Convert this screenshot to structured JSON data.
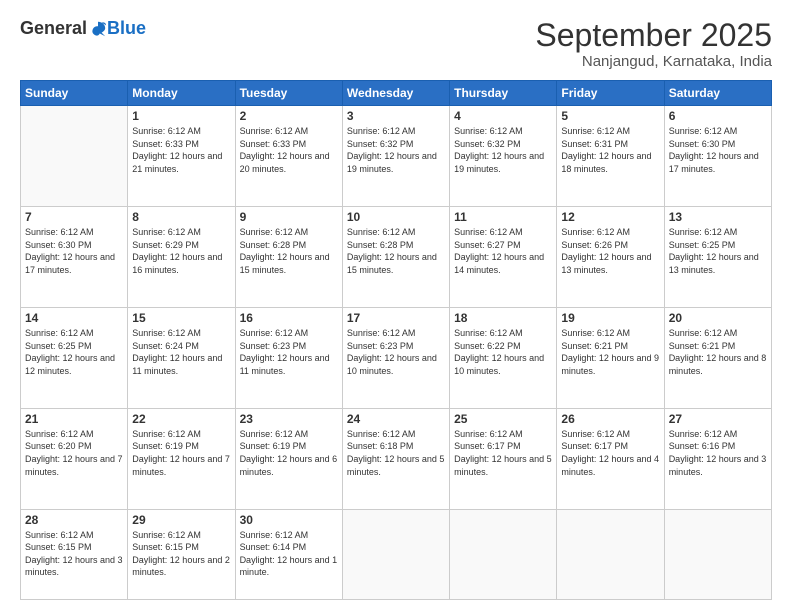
{
  "header": {
    "logo_general": "General",
    "logo_blue": "Blue",
    "month_title": "September 2025",
    "location": "Nanjangud, Karnataka, India"
  },
  "days_of_week": [
    "Sunday",
    "Monday",
    "Tuesday",
    "Wednesday",
    "Thursday",
    "Friday",
    "Saturday"
  ],
  "weeks": [
    [
      {
        "num": "",
        "sunrise": "",
        "sunset": "",
        "daylight": "",
        "empty": true
      },
      {
        "num": "1",
        "sunrise": "Sunrise: 6:12 AM",
        "sunset": "Sunset: 6:33 PM",
        "daylight": "Daylight: 12 hours and 21 minutes."
      },
      {
        "num": "2",
        "sunrise": "Sunrise: 6:12 AM",
        "sunset": "Sunset: 6:33 PM",
        "daylight": "Daylight: 12 hours and 20 minutes."
      },
      {
        "num": "3",
        "sunrise": "Sunrise: 6:12 AM",
        "sunset": "Sunset: 6:32 PM",
        "daylight": "Daylight: 12 hours and 19 minutes."
      },
      {
        "num": "4",
        "sunrise": "Sunrise: 6:12 AM",
        "sunset": "Sunset: 6:32 PM",
        "daylight": "Daylight: 12 hours and 19 minutes."
      },
      {
        "num": "5",
        "sunrise": "Sunrise: 6:12 AM",
        "sunset": "Sunset: 6:31 PM",
        "daylight": "Daylight: 12 hours and 18 minutes."
      },
      {
        "num": "6",
        "sunrise": "Sunrise: 6:12 AM",
        "sunset": "Sunset: 6:30 PM",
        "daylight": "Daylight: 12 hours and 17 minutes."
      }
    ],
    [
      {
        "num": "7",
        "sunrise": "Sunrise: 6:12 AM",
        "sunset": "Sunset: 6:30 PM",
        "daylight": "Daylight: 12 hours and 17 minutes."
      },
      {
        "num": "8",
        "sunrise": "Sunrise: 6:12 AM",
        "sunset": "Sunset: 6:29 PM",
        "daylight": "Daylight: 12 hours and 16 minutes."
      },
      {
        "num": "9",
        "sunrise": "Sunrise: 6:12 AM",
        "sunset": "Sunset: 6:28 PM",
        "daylight": "Daylight: 12 hours and 15 minutes."
      },
      {
        "num": "10",
        "sunrise": "Sunrise: 6:12 AM",
        "sunset": "Sunset: 6:28 PM",
        "daylight": "Daylight: 12 hours and 15 minutes."
      },
      {
        "num": "11",
        "sunrise": "Sunrise: 6:12 AM",
        "sunset": "Sunset: 6:27 PM",
        "daylight": "Daylight: 12 hours and 14 minutes."
      },
      {
        "num": "12",
        "sunrise": "Sunrise: 6:12 AM",
        "sunset": "Sunset: 6:26 PM",
        "daylight": "Daylight: 12 hours and 13 minutes."
      },
      {
        "num": "13",
        "sunrise": "Sunrise: 6:12 AM",
        "sunset": "Sunset: 6:25 PM",
        "daylight": "Daylight: 12 hours and 13 minutes."
      }
    ],
    [
      {
        "num": "14",
        "sunrise": "Sunrise: 6:12 AM",
        "sunset": "Sunset: 6:25 PM",
        "daylight": "Daylight: 12 hours and 12 minutes."
      },
      {
        "num": "15",
        "sunrise": "Sunrise: 6:12 AM",
        "sunset": "Sunset: 6:24 PM",
        "daylight": "Daylight: 12 hours and 11 minutes."
      },
      {
        "num": "16",
        "sunrise": "Sunrise: 6:12 AM",
        "sunset": "Sunset: 6:23 PM",
        "daylight": "Daylight: 12 hours and 11 minutes."
      },
      {
        "num": "17",
        "sunrise": "Sunrise: 6:12 AM",
        "sunset": "Sunset: 6:23 PM",
        "daylight": "Daylight: 12 hours and 10 minutes."
      },
      {
        "num": "18",
        "sunrise": "Sunrise: 6:12 AM",
        "sunset": "Sunset: 6:22 PM",
        "daylight": "Daylight: 12 hours and 10 minutes."
      },
      {
        "num": "19",
        "sunrise": "Sunrise: 6:12 AM",
        "sunset": "Sunset: 6:21 PM",
        "daylight": "Daylight: 12 hours and 9 minutes."
      },
      {
        "num": "20",
        "sunrise": "Sunrise: 6:12 AM",
        "sunset": "Sunset: 6:21 PM",
        "daylight": "Daylight: 12 hours and 8 minutes."
      }
    ],
    [
      {
        "num": "21",
        "sunrise": "Sunrise: 6:12 AM",
        "sunset": "Sunset: 6:20 PM",
        "daylight": "Daylight: 12 hours and 7 minutes."
      },
      {
        "num": "22",
        "sunrise": "Sunrise: 6:12 AM",
        "sunset": "Sunset: 6:19 PM",
        "daylight": "Daylight: 12 hours and 7 minutes."
      },
      {
        "num": "23",
        "sunrise": "Sunrise: 6:12 AM",
        "sunset": "Sunset: 6:19 PM",
        "daylight": "Daylight: 12 hours and 6 minutes."
      },
      {
        "num": "24",
        "sunrise": "Sunrise: 6:12 AM",
        "sunset": "Sunset: 6:18 PM",
        "daylight": "Daylight: 12 hours and 5 minutes."
      },
      {
        "num": "25",
        "sunrise": "Sunrise: 6:12 AM",
        "sunset": "Sunset: 6:17 PM",
        "daylight": "Daylight: 12 hours and 5 minutes."
      },
      {
        "num": "26",
        "sunrise": "Sunrise: 6:12 AM",
        "sunset": "Sunset: 6:17 PM",
        "daylight": "Daylight: 12 hours and 4 minutes."
      },
      {
        "num": "27",
        "sunrise": "Sunrise: 6:12 AM",
        "sunset": "Sunset: 6:16 PM",
        "daylight": "Daylight: 12 hours and 3 minutes."
      }
    ],
    [
      {
        "num": "28",
        "sunrise": "Sunrise: 6:12 AM",
        "sunset": "Sunset: 6:15 PM",
        "daylight": "Daylight: 12 hours and 3 minutes."
      },
      {
        "num": "29",
        "sunrise": "Sunrise: 6:12 AM",
        "sunset": "Sunset: 6:15 PM",
        "daylight": "Daylight: 12 hours and 2 minutes."
      },
      {
        "num": "30",
        "sunrise": "Sunrise: 6:12 AM",
        "sunset": "Sunset: 6:14 PM",
        "daylight": "Daylight: 12 hours and 1 minute."
      },
      {
        "num": "",
        "sunrise": "",
        "sunset": "",
        "daylight": "",
        "empty": true
      },
      {
        "num": "",
        "sunrise": "",
        "sunset": "",
        "daylight": "",
        "empty": true
      },
      {
        "num": "",
        "sunrise": "",
        "sunset": "",
        "daylight": "",
        "empty": true
      },
      {
        "num": "",
        "sunrise": "",
        "sunset": "",
        "daylight": "",
        "empty": true
      }
    ]
  ]
}
